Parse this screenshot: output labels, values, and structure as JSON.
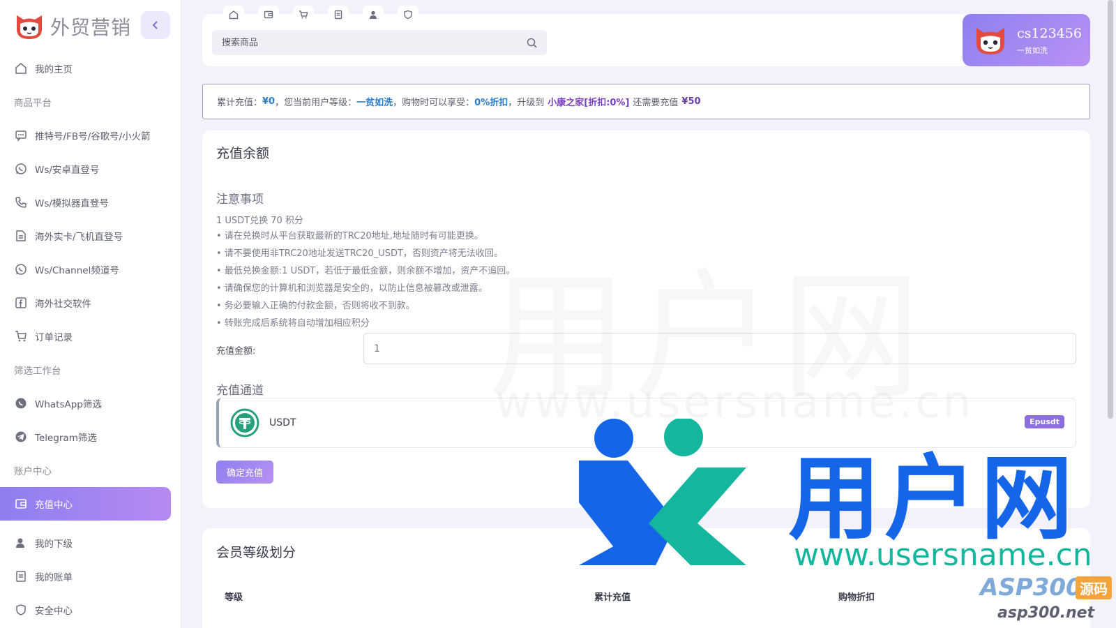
{
  "brand": {
    "name": "外贸营销"
  },
  "sidebar": {
    "items": [
      {
        "type": "item",
        "label": "我的主页",
        "icon": "home-icon"
      },
      {
        "type": "section",
        "label": "商品平台"
      },
      {
        "type": "item",
        "label": "推特号/FB号/谷歌号/小火箭",
        "icon": "message-icon"
      },
      {
        "type": "item",
        "label": "Ws/安卓直登号",
        "icon": "whatsapp-icon"
      },
      {
        "type": "item",
        "label": "Ws/模拟器直登号",
        "icon": "phone-icon"
      },
      {
        "type": "item",
        "label": "海外实卡/飞机直登号",
        "icon": "document-icon"
      },
      {
        "type": "item",
        "label": "Ws/Channel频道号",
        "icon": "whatsapp-icon"
      },
      {
        "type": "item",
        "label": "海外社交软件",
        "icon": "facebook-icon"
      },
      {
        "type": "item",
        "label": "订单记录",
        "icon": "cart-icon"
      },
      {
        "type": "section",
        "label": "筛选工作台"
      },
      {
        "type": "item",
        "label": "WhatsApp筛选",
        "icon": "whatsapp-filled-icon"
      },
      {
        "type": "item",
        "label": "Telegram筛选",
        "icon": "telegram-icon"
      },
      {
        "type": "section",
        "label": "账户中心"
      },
      {
        "type": "item",
        "label": "充值中心",
        "icon": "wallet-icon",
        "active": true
      },
      {
        "type": "item",
        "label": "我的下级",
        "icon": "user-icon"
      },
      {
        "type": "item",
        "label": "我的账单",
        "icon": "bill-icon"
      },
      {
        "type": "item",
        "label": "安全中心",
        "icon": "shield-icon"
      }
    ]
  },
  "topbar": {
    "quick_icons": [
      "home-icon",
      "wallet-icon",
      "cart-icon",
      "bill-icon",
      "user-icon",
      "shield-icon"
    ],
    "search_placeholder": "搜索商品"
  },
  "user": {
    "name": "cs123456",
    "level": "一贫如洗"
  },
  "notice": {
    "p1": "累计充值：",
    "total": "¥0",
    "p2": "，您当前用户等级：",
    "level": "一贫如洗",
    "p3": "，购物时可以享受：",
    "discount": "0%折扣",
    "p4": "，升级到",
    "next_level": "小康之家[折扣:0%]",
    "p5": "还需要充值",
    "need": "¥50"
  },
  "recharge": {
    "title": "充值余额",
    "notes_title": "注意事项",
    "rate": "1 USDT兑换 70 积分",
    "notes": [
      "• 请在兑换时从平台获取最新的TRC20地址,地址随时有可能更换。",
      "• 请不要使用非TRC20地址发送TRC20_USDT，否则资产将无法收回。",
      "• 最低兑换金额:1 USDT，若低于最低金额，则余额不增加，资产不追回。",
      "• 请确保您的计算机和浏览器是安全的，以防止信息被篡改或泄露。",
      "• 务必要输入正确的付款金额，否则将收不到款。",
      "• 转账完成后系统将自动增加相应积分"
    ],
    "amount_label": "充值金额:",
    "amount_value": "1",
    "channel_title": "充值通道",
    "channel_name": "USDT",
    "channel_badge": "Epusdt",
    "confirm_label": "确定充值"
  },
  "levels": {
    "title": "会员等级划分",
    "columns": [
      "等级",
      "累计充值",
      "购物折扣"
    ]
  },
  "watermark": {
    "cn": "用户网",
    "url": "www.usersname.cn",
    "asp": "ASP300",
    "src": "源码",
    "net": "asp300.net"
  },
  "colors": {
    "accent": "#9b85ef",
    "blue": "#2a7ed2",
    "purple": "#7b3fc4",
    "tether": "#26a17b"
  }
}
